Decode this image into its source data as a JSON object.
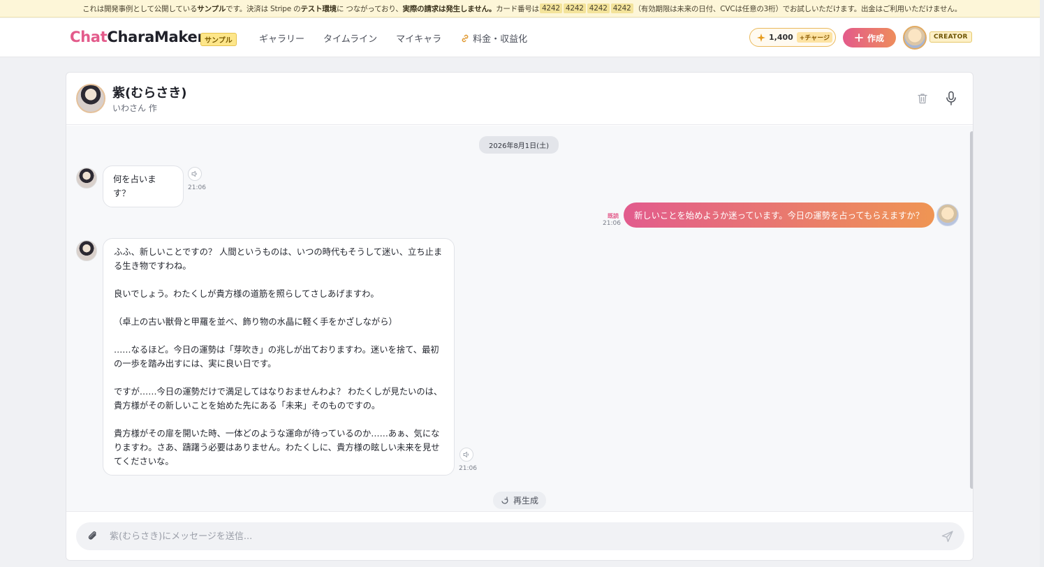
{
  "notice": {
    "part1": "これは開発事例として公開している",
    "sample": "サンプル",
    "part2": "です。決済は Stripe の",
    "test_env": "テスト環境",
    "part3": "に つながっており、",
    "no_charge": "実際の請求は発生しません。",
    "part4": "カード番号は",
    "card_groups": [
      "4242",
      "4242",
      "4242",
      "4242"
    ],
    "part5": "（有効期限は未来の日付、CVCは任意の3桁）でお試しいただけます。出金はご利用いただけません。"
  },
  "header": {
    "logo_chat": "Chat",
    "logo_rest": "CharaMaker",
    "sample_badge": "サンプル",
    "nav": [
      "ギャラリー",
      "タイムライン",
      "マイキャラ",
      "料金・収益化"
    ],
    "points": "1,400",
    "charge_label": "+チャージ",
    "create_label": "作成",
    "creator_badge": "CREATOR"
  },
  "character": {
    "name": "紫(むらさき)",
    "author": "いわさん 作"
  },
  "chat": {
    "date": "2026年8月1日(土)",
    "msg1": {
      "text": "何を占います？",
      "time": "21:06"
    },
    "msg2": {
      "text": "新しいことを始めようか迷っています。今日の運勢を占ってもらえますか？",
      "read": "既読",
      "time": "21:06"
    },
    "msg3": {
      "paragraphs": [
        "ふふ、新しいことですの？ 人間というものは、いつの時代もそうして迷い、立ち止まる生き物ですわね。",
        "良いでしょう。わたくしが貴方様の道筋を照らしてさしあげますわ。",
        "（卓上の古い獣骨と甲羅を並べ、飾り物の水晶に軽く手をかざしながら）",
        "……なるほど。今日の運勢は「芽吹き」の兆しが出ておりますわ。迷いを捨て、最初の一歩を踏み出すには、実に良い日です。",
        "ですが……今日の運勢だけで満足してはなりおませんわよ？ わたくしが見たいのは、貴方様がその新しいことを始めた先にある「未来」そのものですの。",
        "貴方様がその扉を開いた時、一体どのような運命が待っているのか……あぁ、気になりますわ。さあ、躊躇う必要はありません。わたくしに、貴方様の眩しい未来を見せてくださいな。"
      ],
      "time": "21:06"
    },
    "regenerate": "再生成"
  },
  "composer": {
    "placeholder": "紫(むらさき)にメッセージを送信..."
  },
  "colors": {
    "accent_pink": "#e35a8a",
    "accent_orange": "#ee8d5c"
  }
}
